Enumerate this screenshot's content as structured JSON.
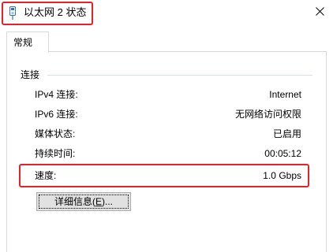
{
  "window": {
    "title": "以太网 2 状态",
    "title_icon": "network-adapter-icon",
    "close_icon": "close-icon"
  },
  "tabs": [
    {
      "label": "常规",
      "selected": true
    }
  ],
  "connection": {
    "group_label": "连接",
    "rows": [
      {
        "label": "IPv4 连接:",
        "value": "Internet"
      },
      {
        "label": "IPv6 连接:",
        "value": "无网络访问权限"
      },
      {
        "label": "媒体状态:",
        "value": "已启用"
      },
      {
        "label": "持续时间:",
        "value": "00:05:12"
      },
      {
        "label": "速度:",
        "value": "1.0 Gbps"
      }
    ],
    "details_button": {
      "prefix": "详细信息(",
      "accelerator": "E",
      "suffix": ")..."
    }
  },
  "colors": {
    "highlight": "#e8202a",
    "button_bg": "#e1e1e1",
    "border": "#d9d9d9"
  }
}
